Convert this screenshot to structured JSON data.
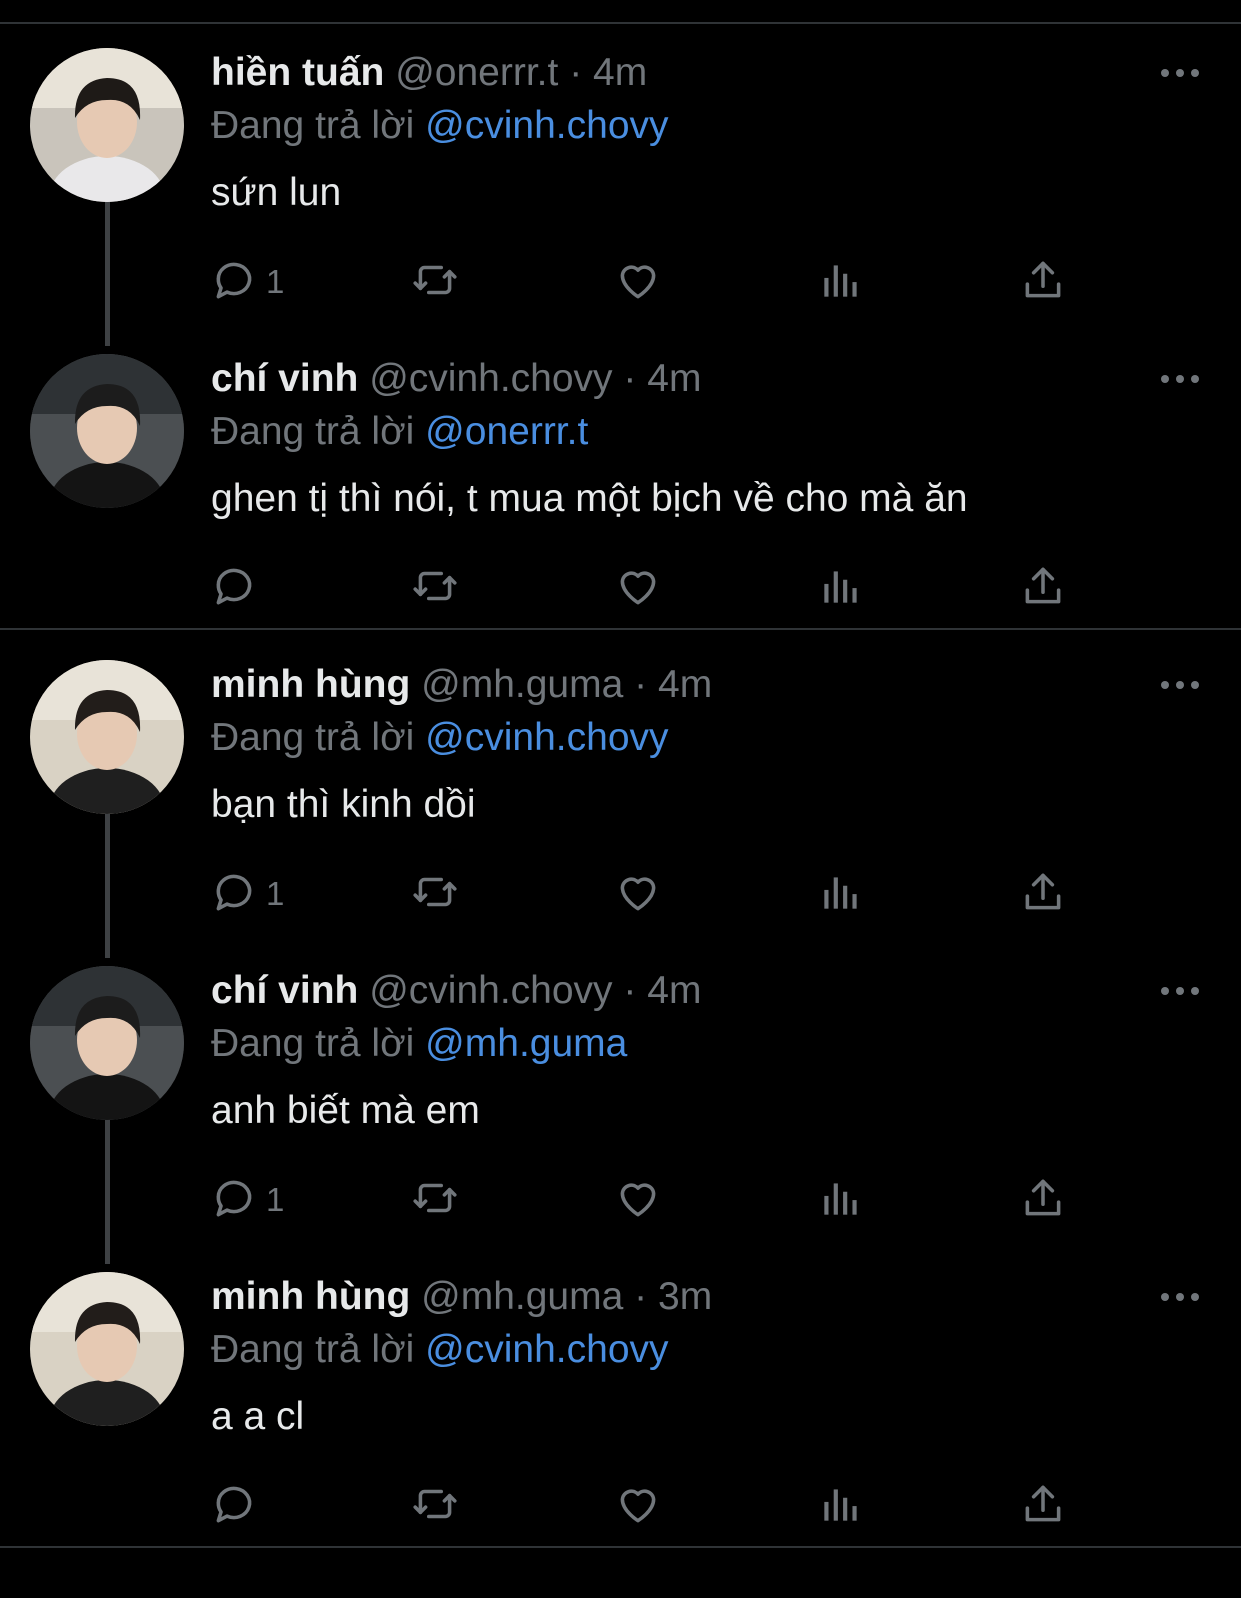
{
  "tweets": [
    {
      "name": "hiền tuấn",
      "handle": "@onerrr.t",
      "time": "4m",
      "reply_prefix": "Đang trả lời",
      "reply_to": "@cvinh.chovy",
      "text": "sứn lun",
      "reply_count": "1"
    },
    {
      "name": "chí vinh",
      "handle": "@cvinh.chovy",
      "time": "4m",
      "reply_prefix": "Đang trả lời",
      "reply_to": "@onerrr.t",
      "text": "ghen tị thì nói, t mua một bịch về cho mà ăn",
      "reply_count": ""
    },
    {
      "name": "minh hùng",
      "handle": "@mh.guma",
      "time": "4m",
      "reply_prefix": "Đang trả lời",
      "reply_to": "@cvinh.chovy",
      "text": "bạn thì kinh dồi",
      "reply_count": "1"
    },
    {
      "name": "chí vinh",
      "handle": "@cvinh.chovy",
      "time": "4m",
      "reply_prefix": "Đang trả lời",
      "reply_to": "@mh.guma",
      "text": "anh biết mà em",
      "reply_count": "1"
    },
    {
      "name": "minh hùng",
      "handle": "@mh.guma",
      "time": "3m",
      "reply_prefix": "Đang trả lời",
      "reply_to": "@cvinh.chovy",
      "text": "a a cl",
      "reply_count": ""
    }
  ],
  "separator": "·",
  "icons": [
    "reply-icon",
    "retweet-icon",
    "like-icon",
    "views-icon",
    "share-icon",
    "more-icon"
  ],
  "colors": {
    "background": "#000000",
    "text": "#e7e9ea",
    "muted": "#71767b",
    "mention": "#4a8ee0",
    "divider": "#2f3336"
  }
}
